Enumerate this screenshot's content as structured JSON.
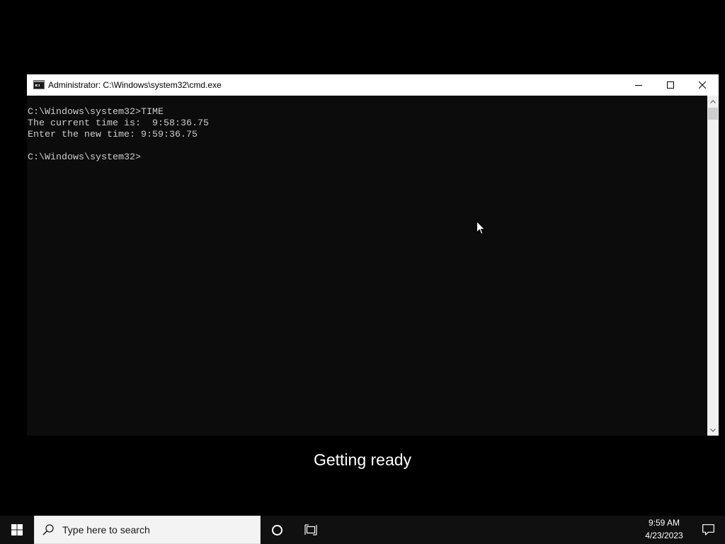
{
  "window": {
    "title": "Administrator: C:\\Windows\\system32\\cmd.exe",
    "app_icon": "cmd-icon",
    "controls": {
      "minimize": "minimize-icon",
      "maximize": "maximize-icon",
      "close": "close-icon"
    }
  },
  "console": {
    "lines": [
      "",
      "C:\\Windows\\system32>TIME",
      "The current time is:  9:58:36.75",
      "Enter the new time: 9:59:36.75",
      "",
      "C:\\Windows\\system32>"
    ],
    "scrollbar": {
      "up_icon": "scroll-up-arrow-icon",
      "down_icon": "scroll-down-arrow-icon"
    }
  },
  "status": {
    "message": "Getting ready"
  },
  "taskbar": {
    "start_icon": "windows-logo-icon",
    "search": {
      "icon": "search-icon",
      "placeholder": "Type here to search"
    },
    "cortana_icon": "cortana-icon",
    "task_view_icon": "task-view-icon",
    "clock": {
      "time": "9:59 AM",
      "date": "4/23/2023"
    },
    "notification_icon": "action-center-icon"
  },
  "colors": {
    "desktop_bg": "#000000",
    "console_bg": "#0c0c0c",
    "console_text": "#cccccc",
    "titlebar_bg": "#ffffff",
    "taskbar_bg": "#101010",
    "search_bg": "#f3f3f3"
  }
}
